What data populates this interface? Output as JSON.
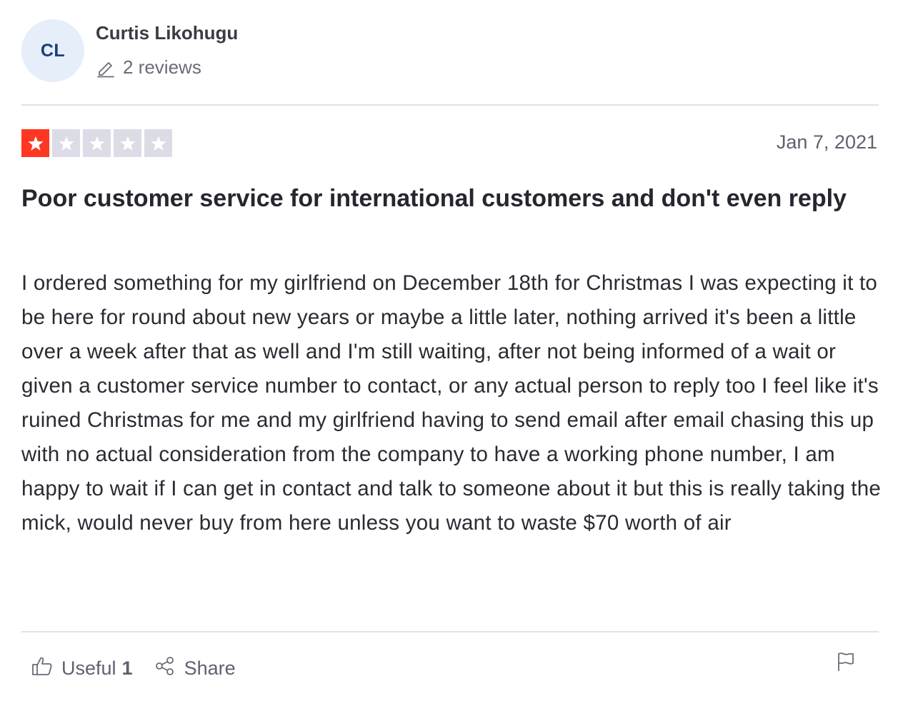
{
  "consumer": {
    "initials": "CL",
    "name": "Curtis Likohugu",
    "reviews_count": "2 reviews",
    "icon": "pencil-icon"
  },
  "review": {
    "rating": 1,
    "max_rating": 5,
    "date": "Jan 7, 2021",
    "title": "Poor customer service for international customers and don't even reply",
    "text": "I ordered something for my girlfriend on December 18th for Christmas I was expecting it to be here for round about new years or maybe a little later, nothing arrived it's been a little over a week after that as well and I'm still waiting, after not being informed of a wait or given a customer service number to contact, or any actual person to reply too I feel like it's ruined Christmas for me and my girlfriend having to send email after email chasing this up with no actual consideration from the company to have a working phone number, I am happy to wait if I can get in contact and talk to someone about it but this is really taking the mick, would never buy from here unless you want to waste $70 worth of air"
  },
  "actions": {
    "useful_label": "Useful",
    "useful_count": "1",
    "share_label": "Share",
    "icons": [
      "thumbs-up-icon",
      "share-icon",
      "flag-icon"
    ]
  },
  "colors": {
    "star_filled": "#ff3722",
    "star_empty": "#dcdce6",
    "avatar_bg": "#e5eef9",
    "avatar_text": "#1c3f77"
  }
}
